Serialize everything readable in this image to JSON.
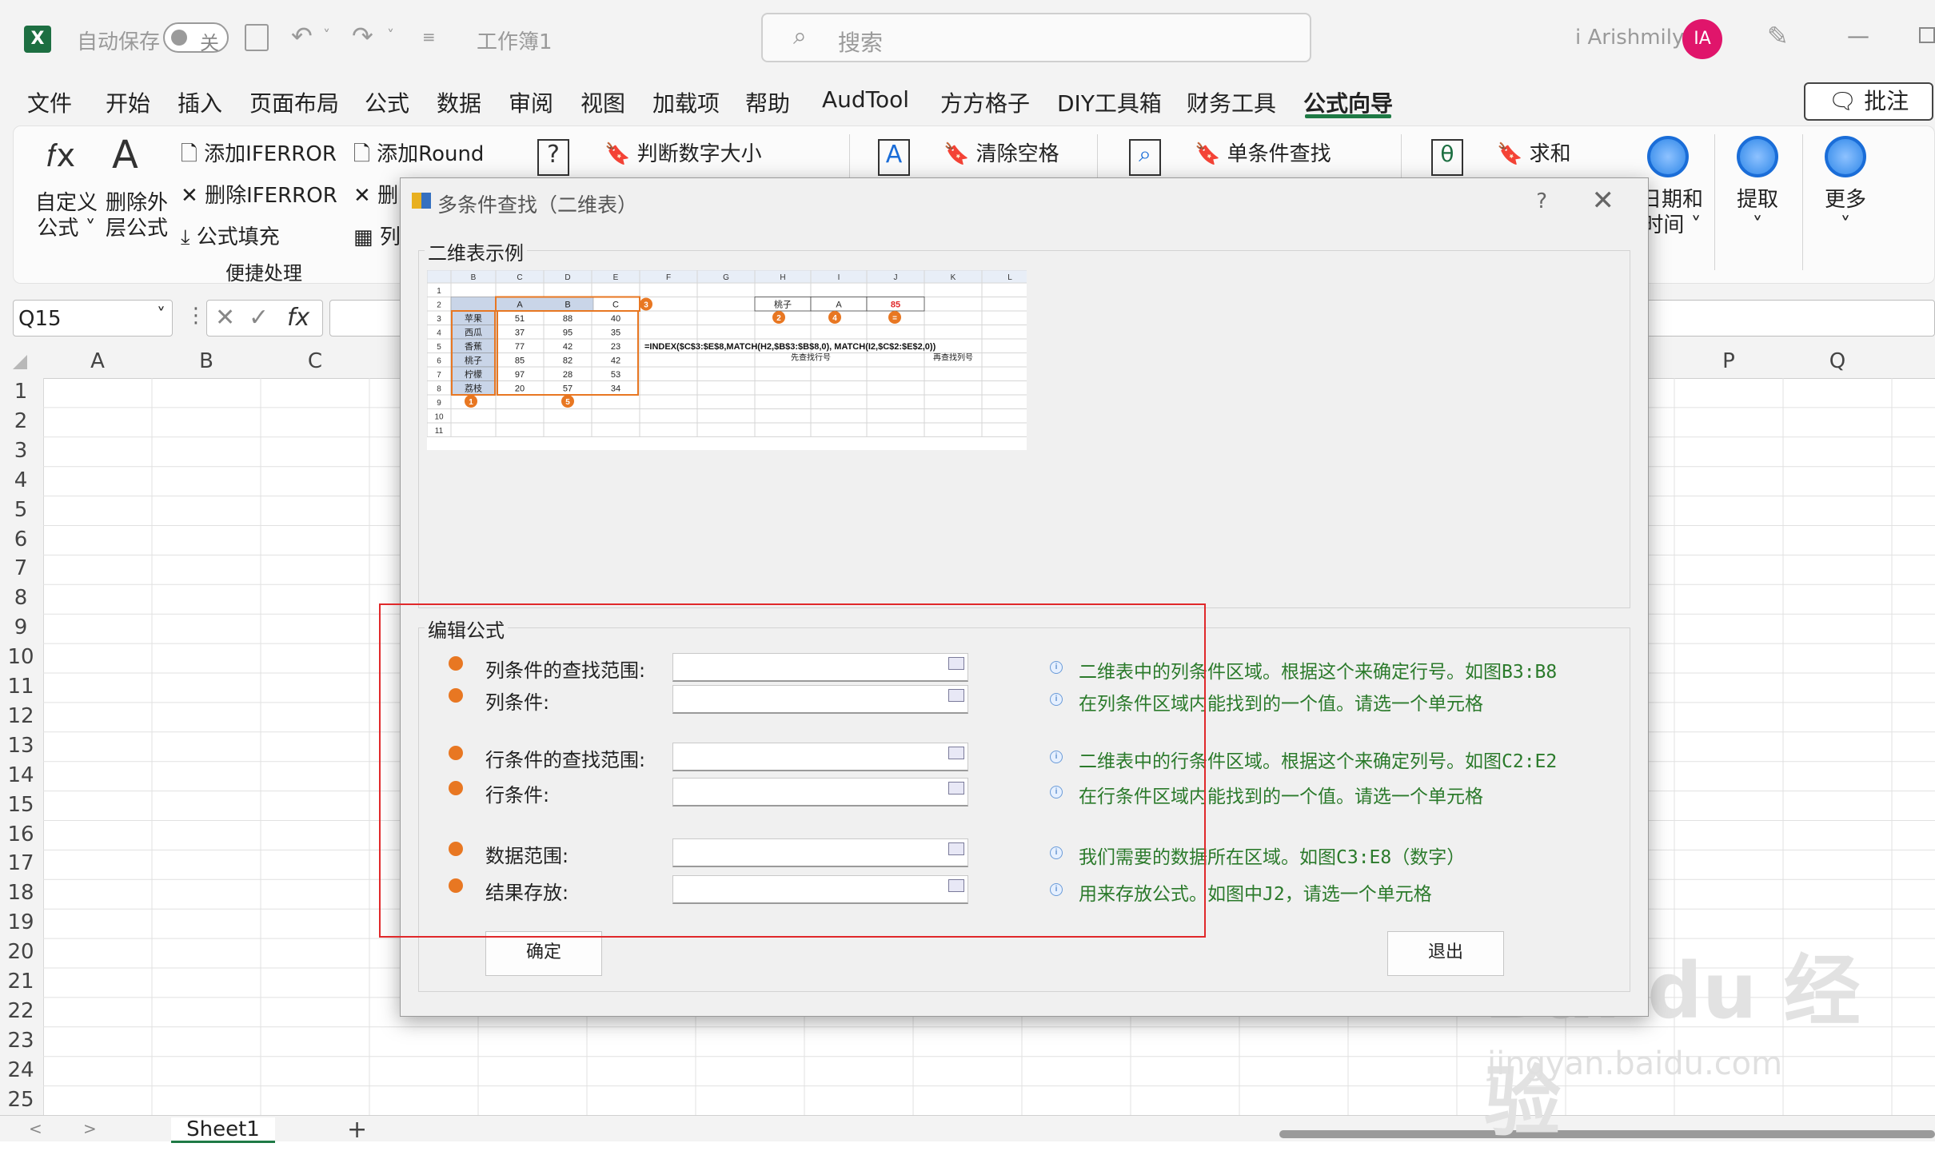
{
  "titlebar": {
    "autosave_label": "自动保存",
    "autosave_state": "关",
    "workbook": "工作簿1",
    "search_placeholder": "搜索",
    "user": "i Arishmily",
    "avatar": "IA"
  },
  "menu": {
    "items": [
      "文件",
      "开始",
      "插入",
      "页面布局",
      "公式",
      "数据",
      "审阅",
      "视图",
      "加载项",
      "帮助",
      "AudTool",
      "方方格子",
      "DIY工具箱",
      "财务工具",
      "公式向导"
    ],
    "active": "公式向导",
    "comment_button": "批注"
  },
  "ribbon": {
    "custom_formula": [
      "自定义",
      "公式 ˅"
    ],
    "remove_formula": [
      "删除外",
      "层公式"
    ],
    "add_iferror": "添加IFERROR",
    "remove_iferror": "删除IFERROR",
    "formula_fill": "公式填充",
    "add_round": "添加Round",
    "remove_partial": "删",
    "col_partial": "列",
    "group_label": "便捷处理",
    "judge_number": "判断数字大小",
    "clear_spaces": "清除空格",
    "single_lookup": "单条件查找",
    "sum": "求和",
    "date_time": [
      "日期和",
      "时间 ˅"
    ],
    "extract": [
      "提取",
      "˅"
    ],
    "more": [
      "更多",
      "˅"
    ]
  },
  "formula_bar": {
    "name_box": "Q15",
    "fx": "fx"
  },
  "grid": {
    "columns_left": [
      "A",
      "B",
      "C"
    ],
    "columns_right": [
      "P",
      "Q"
    ],
    "rows": [
      "1",
      "2",
      "3",
      "4",
      "5",
      "6",
      "7",
      "8",
      "9",
      "10",
      "11",
      "12",
      "13",
      "14",
      "15",
      "16",
      "17",
      "18",
      "19",
      "20",
      "21",
      "22",
      "23",
      "24",
      "25"
    ]
  },
  "sheet_tab": "Sheet1",
  "add_sheet": "+",
  "dialog": {
    "title": "多条件查找（二维表）",
    "help": "?",
    "close": "✕",
    "example_group": "二维表示例",
    "edit_group": "编辑公式",
    "fields": [
      {
        "label": "列条件的查找范围:",
        "desc": "二维表中的列条件区域。根据这个来确定行号。如图B3:B8"
      },
      {
        "label": "列条件:",
        "desc": "在列条件区域内能找到的一个值。请选一个单元格"
      },
      {
        "label": "行条件的查找范围:",
        "desc": "二维表中的行条件区域。根据这个来确定列号。如图C2:E2"
      },
      {
        "label": "行条件:",
        "desc": "在行条件区域内能找到的一个值。请选一个单元格"
      },
      {
        "label": "数据范围:",
        "desc": "我们需要的数据所在区域。如图C3:E8（数字）"
      },
      {
        "label": "结果存放:",
        "desc": "用来存放公式。如图中J2，请选一个单元格"
      }
    ],
    "ok": "确定",
    "exit": "退出"
  },
  "example": {
    "col_headers": [
      "B",
      "C",
      "D",
      "E",
      "F",
      "G",
      "H",
      "I",
      "J",
      "K",
      "L"
    ],
    "row_nums": [
      "1",
      "2",
      "3",
      "4",
      "5",
      "6",
      "7",
      "8",
      "9",
      "10",
      "11"
    ],
    "abc": [
      "A",
      "B",
      "C"
    ],
    "fruits": [
      "苹果",
      "西瓜",
      "香蕉",
      "桃子",
      "柠檬",
      "荔枝"
    ],
    "values": [
      [
        "51",
        "88",
        "40"
      ],
      [
        "37",
        "95",
        "35"
      ],
      [
        "77",
        "42",
        "23"
      ],
      [
        "85",
        "82",
        "42"
      ],
      [
        "97",
        "28",
        "53"
      ],
      [
        "20",
        "57",
        "34"
      ]
    ],
    "lookup": [
      "桃子",
      "A",
      "85"
    ],
    "formula": "=INDEX($C$3:$E$8,MATCH(H2,$B$3:$B$8,0), MATCH(I2,$C$2:$E$2,0))",
    "note1": "先查找行号",
    "note2": "再查找列号",
    "markers": [
      "1",
      "2",
      "3",
      "4",
      "5",
      "="
    ]
  },
  "watermark": {
    "main": "Bai du 经验",
    "sub": "jingyan.baidu.com"
  }
}
